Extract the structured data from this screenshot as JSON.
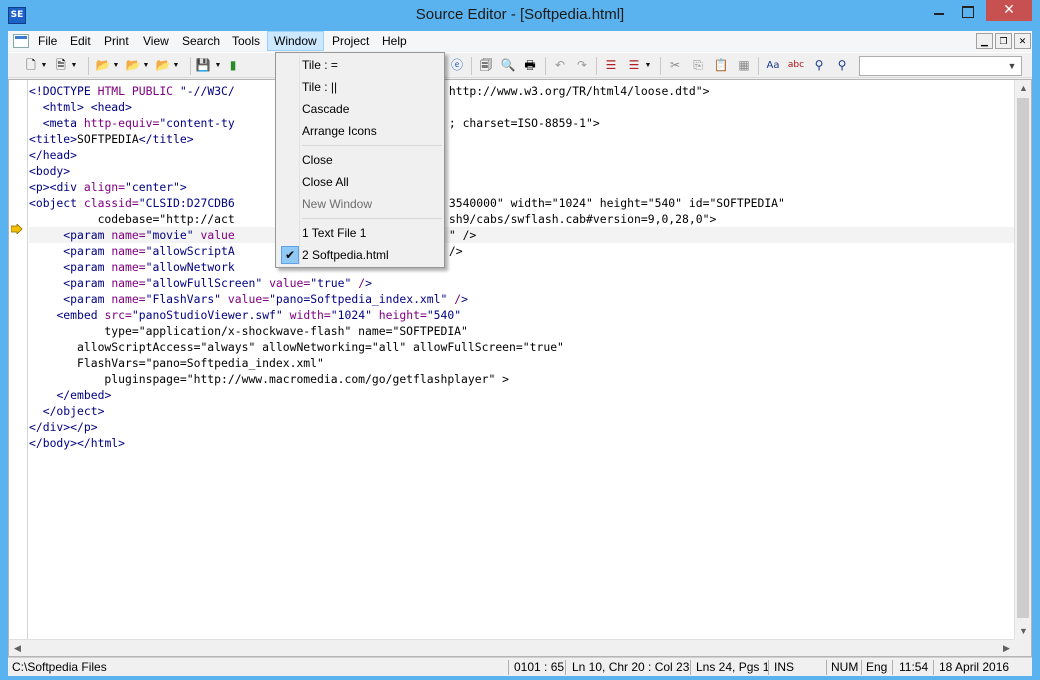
{
  "window": {
    "title": "Source Editor - [Softpedia.html]",
    "app_icon": "SE",
    "controls": {
      "close": "✕"
    }
  },
  "menubar": {
    "items": [
      "File",
      "Edit",
      "Print",
      "View",
      "Search",
      "Tools",
      "Window",
      "Project",
      "Help"
    ],
    "active": "Window"
  },
  "toolbar": {
    "search_combo_value": ""
  },
  "window_menu": {
    "items": [
      {
        "label": "Tile : =",
        "enabled": true
      },
      {
        "label": "Tile : ||",
        "enabled": true
      },
      {
        "label": "Cascade",
        "enabled": true
      },
      {
        "label": "Arrange Icons",
        "enabled": true
      },
      {
        "label": "Close",
        "enabled": true
      },
      {
        "label": "Close All",
        "enabled": true
      },
      {
        "label": "New Window",
        "enabled": false
      },
      {
        "label": "1 Text File 1",
        "enabled": true
      },
      {
        "label": "2 Softpedia.html",
        "enabled": true,
        "checked": true
      }
    ]
  },
  "editor": {
    "current_line": 10,
    "lines": [
      "<!DOCTYPE HTML PUBLIC \"-//W3C/",
      "  <html> <head>",
      "  <meta http-equiv=\"content-ty",
      "<title>SOFTPEDIA</title>",
      "</head>",
      "<body>",
      "<p><div align=\"center\">",
      "<object classid=\"CLSID:D27CDB6",
      "          codebase=\"http://act",
      "     <param name=\"movie\" value",
      "     <param name=\"allowScriptA",
      "     <param name=\"allowNetwork",
      "     <param name=\"allowFullScreen\" value=\"true\" />",
      "     <param name=\"FlashVars\" value=\"pano=Softpedia_index.xml\" />",
      "    <embed src=\"panoStudioViewer.swf\" width=\"1024\" height=\"540\"",
      "           type=\"application/x-shockwave-flash\" name=\"SOFTPEDIA\"",
      "       allowScriptAccess=\"always\" allowNetworking=\"all\" allowFullScreen=\"true\"",
      "       FlashVars=\"pano=Softpedia_index.xml\"",
      "           pluginspage=\"http://www.macromedia.com/go/getflashplayer\" >",
      "    </embed>",
      "  </object>",
      "</div></p>",
      "</body></html>"
    ],
    "right_fragments": [
      "http://www.w3.org/TR/html4/loose.dtd\">",
      "",
      "; charset=ISO-8859-1\">",
      "",
      "",
      "",
      "",
      "3540000\" width=\"1024\" height=\"540\" id=\"SOFTPEDIA\"",
      "sh9/cabs/swflash.cab#version=9,0,28,0\">",
      "\" />",
      "/>"
    ]
  },
  "statusbar": {
    "path": "C:\\Softpedia Files",
    "offset": "0101 : 65",
    "position": "Ln 10, Chr 20 : Col 23",
    "totals": "Lns 24, Pgs 1",
    "ins": "INS",
    "num": "NUM",
    "lang": "Eng",
    "time": "11:54",
    "date": "18 April 2016"
  },
  "colors": {
    "frame": "#5ab2ee",
    "close_button": "#c75050",
    "menu_highlight": "#cce8ff",
    "check_box": "#90c8f6",
    "code_tag": "#000080",
    "code_attr": "#800080",
    "code_text": "#000000"
  },
  "icons": {
    "bookmark": "current-line-arrow-icon",
    "check": "checkmark-icon"
  }
}
